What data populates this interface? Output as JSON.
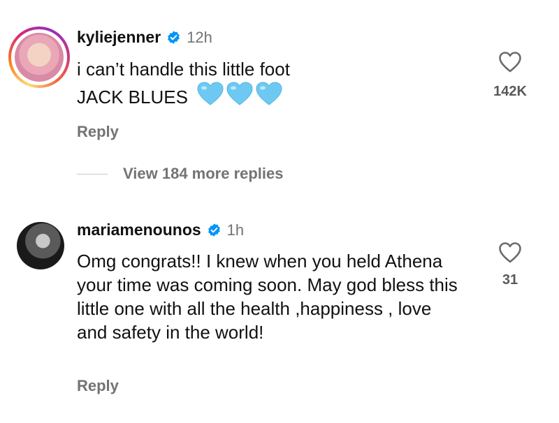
{
  "comments": [
    {
      "username": "kyliejenner",
      "verified": true,
      "time": "12h",
      "text_line1": "i can’t handle this little foot",
      "text_line2": "JACK BLUES",
      "emoji": "light-blue-heart-emoji",
      "emoji_count": 3,
      "likes": "142K",
      "reply_label": "Reply"
    },
    {
      "username": "mariamenounos",
      "verified": true,
      "time": "1h",
      "text": "Omg congrats!! I knew when you held Athena your time was coming soon. May god bless this little one with all the health ,happiness , love and safety in the world!",
      "likes": "31",
      "reply_label": "Reply"
    }
  ],
  "view_replies_label": "View 184 more replies",
  "icons": {
    "verified": "verified-badge-icon",
    "like": "heart-outline-icon"
  },
  "colors": {
    "verified_blue": "#0095f6",
    "muted_text": "#737373",
    "emoji_heart": "#6ec9f2"
  }
}
